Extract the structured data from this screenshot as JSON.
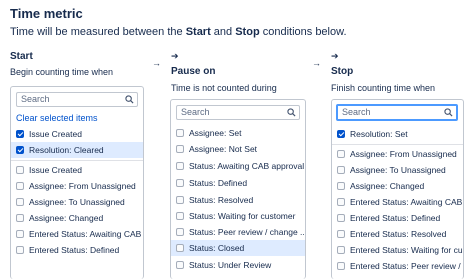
{
  "header": {
    "title": "Time metric",
    "desc_pre": "Time will be measured between the ",
    "desc_start": "Start",
    "desc_mid": " and ",
    "desc_stop": "Stop",
    "desc_post": " conditions below."
  },
  "start": {
    "heading": "Start",
    "subtitle": "Begin counting time when",
    "search_placeholder": "Search",
    "clear_label": "Clear selected items",
    "selected": [
      "Issue Created",
      "Resolution: Cleared"
    ],
    "items": [
      "Issue Created",
      "Assignee: From Unassigned",
      "Assignee: To Unassigned",
      "Assignee: Changed",
      "Entered Status: Awaiting CAB a...",
      "Entered Status: Defined"
    ]
  },
  "pause": {
    "arrow": "➔",
    "heading": "Pause on",
    "subtitle": "Time is not counted during",
    "search_placeholder": "Search",
    "items": [
      "Assignee: Set",
      "Assignee: Not Set",
      "Status: Awaiting CAB approval",
      "Status: Defined",
      "Status: Resolved",
      "Status: Waiting for customer",
      "Status: Peer review / change ...",
      "Status: Closed",
      "Status: Under Review"
    ]
  },
  "stop": {
    "arrow": "➔",
    "heading": "Stop",
    "subtitle": "Finish counting time when",
    "search_placeholder": "Search",
    "selected": [
      "Resolution: Set"
    ],
    "items": [
      "Assignee: From Unassigned",
      "Assignee: To Unassigned",
      "Assignee: Changed",
      "Entered Status: Awaiting CAB ...",
      "Entered Status: Defined",
      "Entered Status: Resolved",
      "Entered Status: Waiting for cu...",
      "Entered Status: Peer review / c..."
    ]
  },
  "separators": [
    "→",
    "→"
  ]
}
